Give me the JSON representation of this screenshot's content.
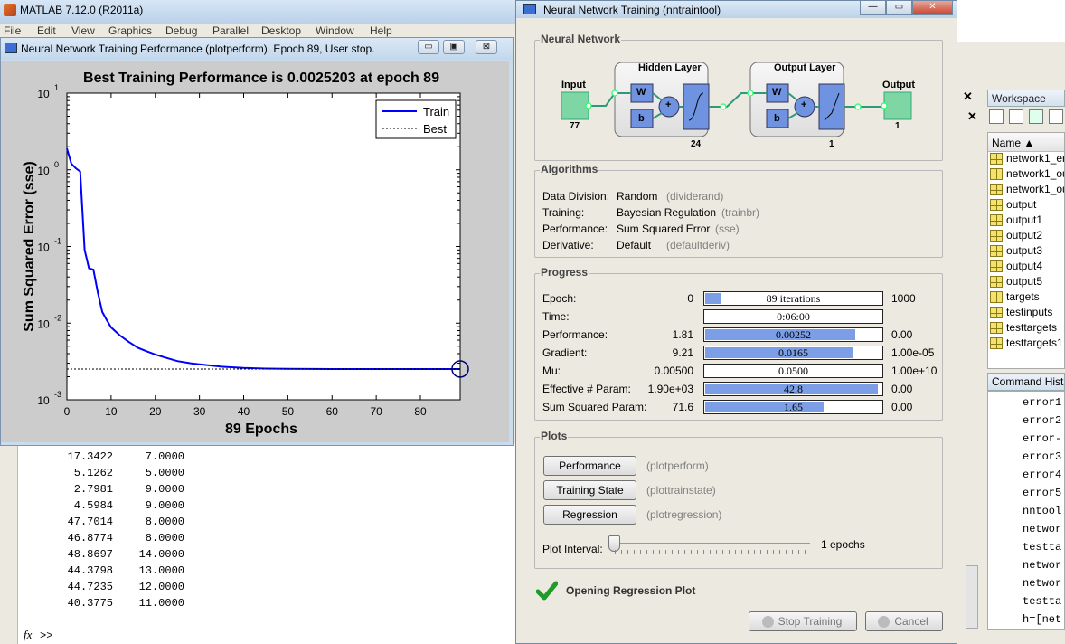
{
  "matlab": {
    "title": "MATLAB  7.12.0 (R2011a)",
    "menu": [
      "File",
      "Edit",
      "View",
      "Graphics",
      "Debug",
      "Parallel",
      "Desktop",
      "Window",
      "Help"
    ],
    "output_rows": [
      [
        "17.3422",
        "7.0000"
      ],
      [
        "5.1262",
        "5.0000"
      ],
      [
        "2.7981",
        "9.0000"
      ],
      [
        "4.5984",
        "9.0000"
      ],
      [
        "47.7014",
        "8.0000"
      ],
      [
        "46.8774",
        "8.0000"
      ],
      [
        "48.8697",
        "14.0000"
      ],
      [
        "44.3798",
        "13.0000"
      ],
      [
        "44.7235",
        "12.0000"
      ],
      [
        "40.3775",
        "11.0000"
      ]
    ],
    "fx_label": "fx",
    "prompt": ">>"
  },
  "plot_window": {
    "title": "Neural Network Training Performance (plotperform), Epoch 89, User stop.",
    "min": "▭",
    "max": "▣",
    "close": "⊠"
  },
  "chart_data": {
    "type": "line",
    "title": "Best Training Performance is 0.0025203 at epoch 89",
    "xlabel": "89 Epochs",
    "ylabel": "Sum Squared Error  (sse)",
    "xlim": [
      0,
      89
    ],
    "ylim": [
      0.001,
      10
    ],
    "yscale": "log",
    "xticks": [
      "0",
      "10",
      "20",
      "30",
      "40",
      "50",
      "60",
      "70",
      "80"
    ],
    "yticks": [
      {
        "base": "10",
        "exp": "1"
      },
      {
        "base": "10",
        "exp": "0"
      },
      {
        "base": "10",
        "exp": "-1"
      },
      {
        "base": "10",
        "exp": "-2"
      },
      {
        "base": "10",
        "exp": "-3"
      }
    ],
    "legend": {
      "placement": "top-right",
      "entries": [
        "Train",
        "Best"
      ]
    },
    "series": [
      {
        "name": "Train",
        "color": "#0000ff",
        "x": [
          0,
          1,
          2,
          3,
          4,
          5,
          6,
          7,
          8,
          9,
          10,
          12,
          14,
          16,
          18,
          20,
          22,
          25,
          28,
          30,
          35,
          40,
          45,
          50,
          60,
          70,
          80,
          89
        ],
        "y": [
          1.9,
          1.2,
          1.05,
          0.95,
          0.09,
          0.052,
          0.05,
          0.025,
          0.014,
          0.011,
          0.0088,
          0.0069,
          0.0057,
          0.0048,
          0.0043,
          0.0039,
          0.0036,
          0.0032,
          0.003,
          0.0029,
          0.0027,
          0.0026,
          0.00255,
          0.00253,
          0.00252,
          0.00252,
          0.00252,
          0.0025203
        ]
      },
      {
        "name": "Best",
        "style": "dotted",
        "y_value": 0.0025203,
        "x_value": 89
      }
    ]
  },
  "nn_window": {
    "title": "Neural Network Training (nntraintool)",
    "min": "—",
    "max": "▭",
    "close": "✕",
    "network": {
      "group": "Neural Network",
      "input": "Input",
      "input_n": "77",
      "hidden": "Hidden Layer",
      "hidden_n": "24",
      "output_layer": "Output Layer",
      "output_n": "1",
      "output": "Output",
      "output_out_n": "1",
      "w": "W",
      "b": "b",
      "plus": "+"
    },
    "algorithms": {
      "group": "Algorithms",
      "rows": [
        [
          "Data Division:",
          "Random",
          "(dividerand)"
        ],
        [
          "Training:",
          "Bayesian Regulation",
          "(trainbr)"
        ],
        [
          "Performance:",
          "Sum Squared Error",
          "(sse)"
        ],
        [
          "Derivative:",
          "Default",
          "(defaultderiv)"
        ]
      ]
    },
    "progress": {
      "group": "Progress",
      "rows": [
        {
          "label": "Epoch:",
          "start": "0",
          "value": "89 iterations",
          "end": "1000",
          "fill": 0.089
        },
        {
          "label": "Time:",
          "start": "",
          "value": "0:06:00",
          "end": "",
          "fill": 0
        },
        {
          "label": "Performance:",
          "start": "1.81",
          "value": "0.00252",
          "end": "0.00",
          "fill": 0.85
        },
        {
          "label": "Gradient:",
          "start": "9.21",
          "value": "0.0165",
          "end": "1.00e-05",
          "fill": 0.84
        },
        {
          "label": "Mu:",
          "start": "0.00500",
          "value": "0.0500",
          "end": "1.00e+10",
          "fill": 0
        },
        {
          "label": "Effective # Param:",
          "start": "1.90e+03",
          "value": "42.8",
          "end": "0.00",
          "fill": 0.98
        },
        {
          "label": "Sum Squared Param:",
          "start": "71.6",
          "value": "1.65",
          "end": "0.00",
          "fill": 0.67
        }
      ]
    },
    "plots": {
      "group": "Plots",
      "buttons": [
        [
          "Performance",
          "(plotperform)"
        ],
        [
          "Training State",
          "(plottrainstate)"
        ],
        [
          "Regression",
          "(plotregression)"
        ]
      ],
      "interval_label": "Plot Interval:",
      "interval_value": "1 epochs"
    },
    "status": "Opening Regression Plot",
    "stop_btn": "Stop Training",
    "cancel_btn": "Cancel"
  },
  "workspace": {
    "title": "Workspace",
    "name_col": "Name ▲",
    "items": [
      "network1_err",
      "network1_ou",
      "network1_ou",
      "output",
      "output1",
      "output2",
      "output3",
      "output4",
      "output5",
      "targets",
      "testinputs",
      "testtargets",
      "testtargets1"
    ]
  },
  "command_history": {
    "title": "Command Hist",
    "items": [
      "error1",
      "error2",
      "error-",
      "error3",
      "error4",
      "error5",
      "nntool",
      "networ",
      "testta",
      "networ",
      "networ",
      "testta",
      "h=[net"
    ]
  }
}
